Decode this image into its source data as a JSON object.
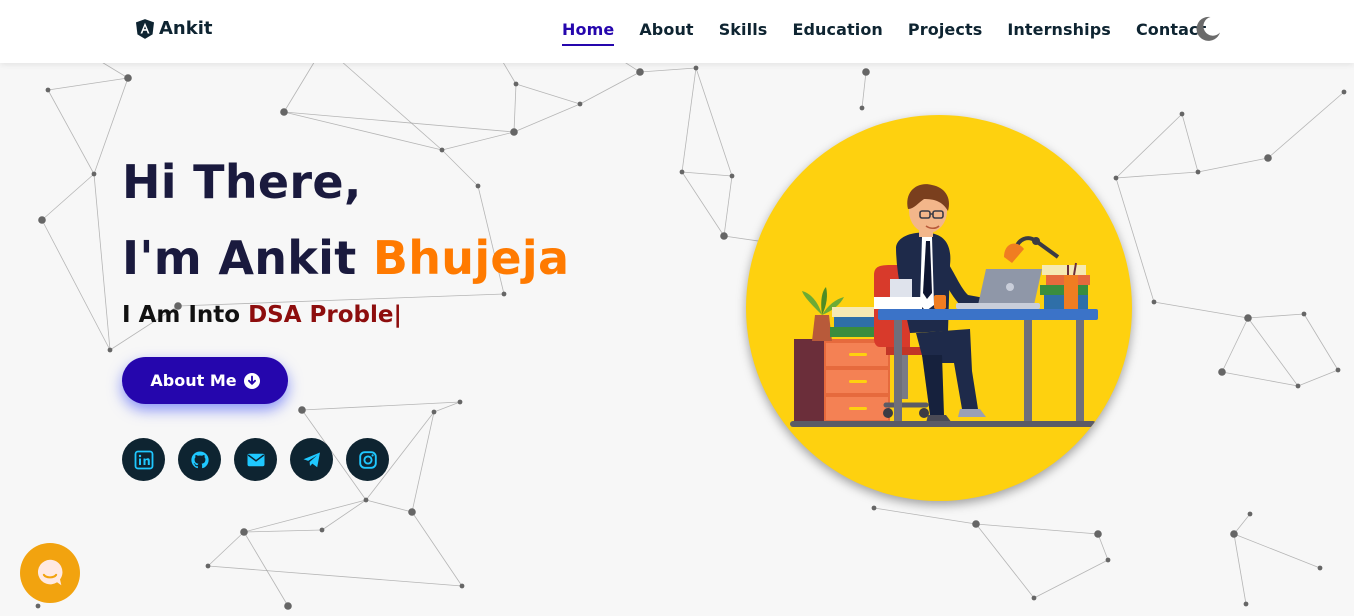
{
  "nav": {
    "brand": "Ankit",
    "links": [
      {
        "label": "Home",
        "active": true
      },
      {
        "label": "About",
        "active": false
      },
      {
        "label": "Skills",
        "active": false
      },
      {
        "label": "Education",
        "active": false
      },
      {
        "label": "Projects",
        "active": false
      },
      {
        "label": "Internships",
        "active": false
      },
      {
        "label": "Contact",
        "active": false
      }
    ],
    "theme_icon": "moon-icon"
  },
  "hero": {
    "greeting": "Hi There,",
    "intro": "I'm Ankit",
    "name_accent": "Bhujeja",
    "typing_prefix": "I Am Into",
    "typing_text": "DSA Proble|",
    "button_label": "About Me",
    "button_icon": "arrow-down-circle-icon",
    "socials": [
      "linkedin-icon",
      "github-icon",
      "mail-icon",
      "telegram-icon",
      "instagram-icon"
    ],
    "illustration": "developer-at-desk-illustration"
  },
  "colors": {
    "primary": "#2506ad",
    "accent": "#ff7a00",
    "typed": "#8d0d0d",
    "dark": "#0e2431",
    "social_icon": "#1fc8ff",
    "circle": "#fed10f",
    "chat": "#f2a30f"
  },
  "chat_widget": {
    "icon": "chat-bubble-icon"
  }
}
